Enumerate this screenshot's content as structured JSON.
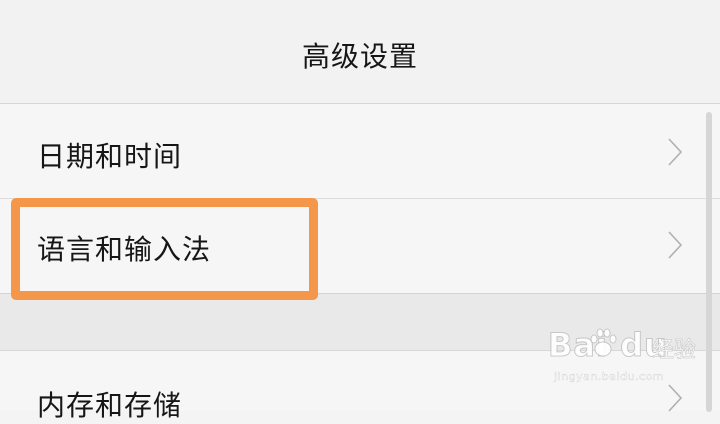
{
  "header": {
    "title": "高级设置"
  },
  "settings": {
    "items": [
      {
        "label": "日期和时间",
        "icon": "chevron-right-icon"
      },
      {
        "label": "语言和输入法",
        "icon": "chevron-right-icon"
      },
      {
        "label": "内存和存储",
        "icon": "chevron-right-icon"
      }
    ]
  },
  "highlight": {
    "color": "#f5974b"
  },
  "watermark": {
    "brand": "Bai du",
    "word": "经验",
    "url": "jingyan.baidu.com"
  }
}
